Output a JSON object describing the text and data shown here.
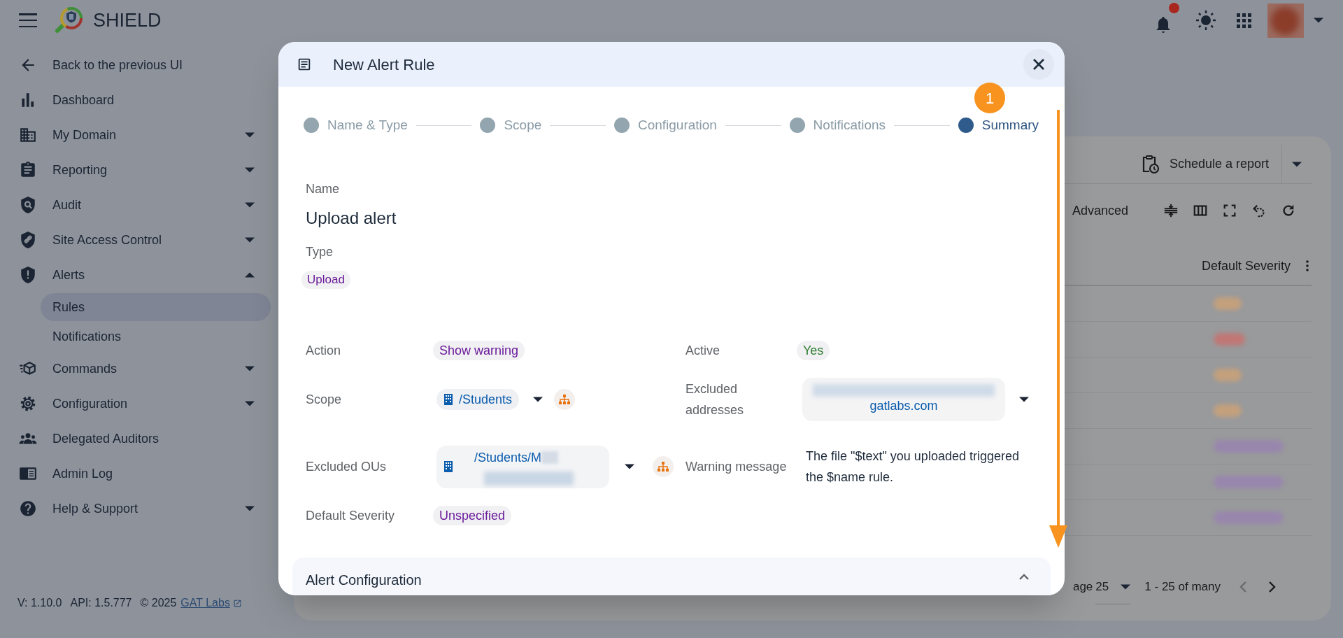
{
  "header": {
    "app_name": "SHIELD",
    "unread": true
  },
  "sidebar": {
    "items": [
      {
        "label": "Back to the previous UI",
        "kind": "link"
      },
      {
        "label": "Dashboard",
        "kind": "link"
      },
      {
        "label": "My Domain",
        "kind": "group",
        "expanded": false
      },
      {
        "label": "Reporting",
        "kind": "group",
        "expanded": false
      },
      {
        "label": "Audit",
        "kind": "group",
        "expanded": false
      },
      {
        "label": "Site Access Control",
        "kind": "group",
        "expanded": false
      },
      {
        "label": "Alerts",
        "kind": "group",
        "expanded": true,
        "children": [
          {
            "label": "Rules",
            "selected": true
          },
          {
            "label": "Notifications",
            "selected": false
          }
        ]
      },
      {
        "label": "Commands",
        "kind": "group",
        "expanded": false
      },
      {
        "label": "Configuration",
        "kind": "group",
        "expanded": false
      },
      {
        "label": "Delegated Auditors",
        "kind": "link"
      },
      {
        "label": "Admin Log",
        "kind": "link"
      },
      {
        "label": "Help & Support",
        "kind": "group",
        "expanded": false
      }
    ],
    "footer": {
      "version": "V: 1.10.0",
      "api": "API: 1.5.777",
      "copyright": "© 2025",
      "link": "GAT Labs"
    }
  },
  "background": {
    "schedule_button": "Schedule a report",
    "advanced": "Advanced",
    "column": "Default Severity",
    "pagination": {
      "per_page_label": "age",
      "per_page": "25",
      "range": "1 - 25 of many"
    }
  },
  "dialog": {
    "title": "New Alert Rule",
    "steps": [
      {
        "label": "Name & Type",
        "selected": false
      },
      {
        "label": "Scope",
        "selected": false
      },
      {
        "label": "Configuration",
        "selected": false
      },
      {
        "label": "Notifications",
        "selected": false
      },
      {
        "label": "Summary",
        "selected": true
      }
    ],
    "name_label": "Name",
    "name": "Upload alert",
    "type_label": "Type",
    "type": "Upload",
    "field_rows": [
      [
        {
          "label": "Action",
          "kind": "chip",
          "value": "Show warning",
          "color": "#6a1b9a"
        },
        {
          "label": "Active",
          "kind": "chip",
          "value": "Yes",
          "color": "#2e7d32"
        }
      ],
      [
        {
          "label": "Scope",
          "kind": "ou-chip",
          "value": "/Students"
        },
        {
          "label": "Excluded addresses",
          "kind": "address-select",
          "value": "gatlabs.com"
        }
      ],
      [
        {
          "label": "Excluded OUs",
          "kind": "ou-select",
          "value": "/Students/M"
        },
        {
          "label": "Warning message",
          "kind": "text",
          "value": "The file \"$text\" you uploaded triggered the $name rule."
        }
      ],
      [
        {
          "label": "Default Severity",
          "kind": "chip",
          "value": "Unspecified",
          "color": "#6a1b9a"
        }
      ]
    ],
    "section": {
      "title": "Alert Configuration",
      "expanded": true
    }
  },
  "annotation": {
    "badge": "1"
  }
}
